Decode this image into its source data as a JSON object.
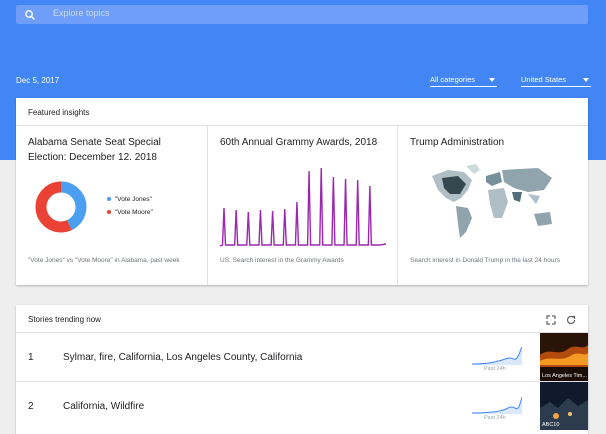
{
  "search": {
    "placeholder": "Explore topics"
  },
  "toolbar": {
    "date": "Dec 5, 2017",
    "category": "All categories",
    "region": "United States"
  },
  "featured": {
    "header": "Featured insights",
    "cards": [
      {
        "title": "Alabama Senate Seat Special Election: December 12. 2018",
        "legend": [
          "\"Vote Jones\"",
          "\"Vote Moore\""
        ],
        "colors": [
          "#4a9ff0",
          "#ea4335"
        ],
        "share": [
          0.43,
          0.57
        ],
        "footer": "\"Vote Jones\" vs \"Vote Moore\" in Alabama, past week"
      },
      {
        "title": "60th Annual Grammy Awards, 2018",
        "color": "#9c27b0",
        "spikes": [
          38,
          36,
          34,
          36,
          35,
          37,
          44,
          75,
          78,
          69,
          67,
          66,
          60
        ],
        "footer": "US: Search interest in the Grammy Awards"
      },
      {
        "title": "Trump Administration",
        "footer": "Search interest in Donald Trump in the last 24 hours"
      }
    ]
  },
  "stories": {
    "header": "Stories trending now",
    "items": [
      {
        "rank": "1",
        "title": "Sylmar, fire, California, Los Angeles County, California",
        "spark_label": "Past 24h",
        "image_caption": "Los Angeles Tim..."
      },
      {
        "rank": "2",
        "title": "California, Wildfire",
        "spark_label": "Past 24h",
        "image_caption": "ABC10"
      }
    ]
  }
}
